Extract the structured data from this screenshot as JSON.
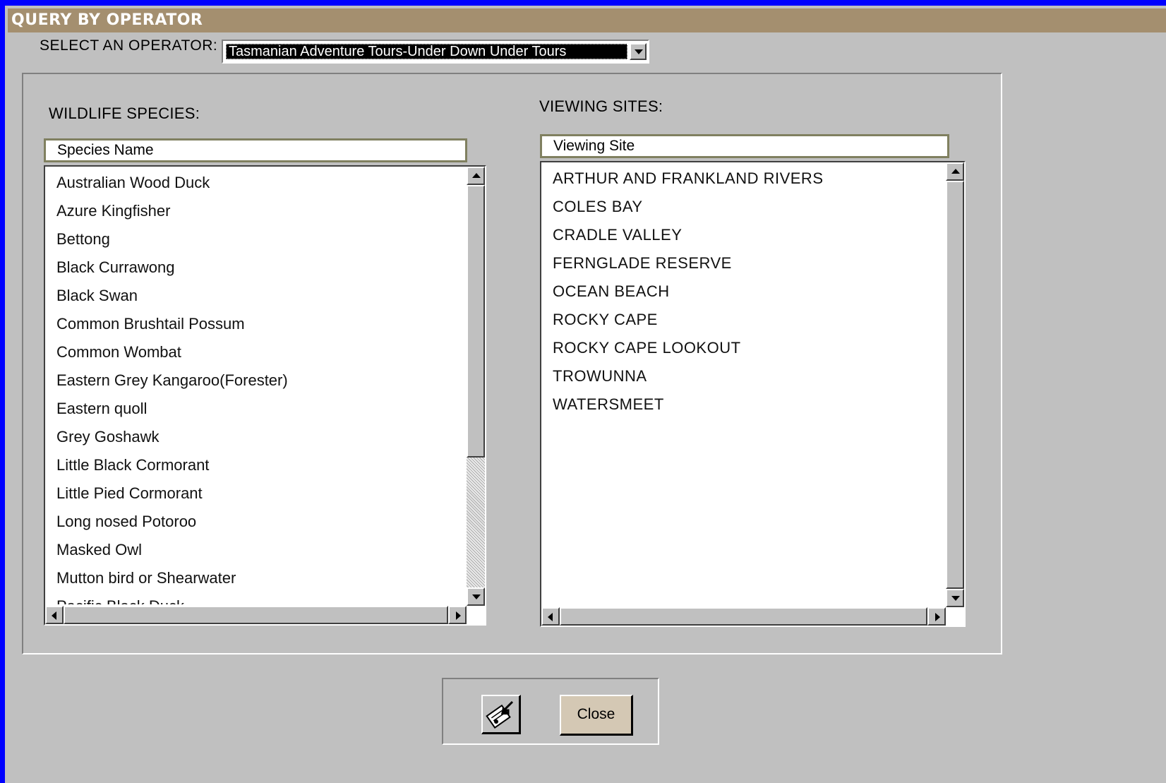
{
  "window": {
    "title": "QUERY BY OPERATOR"
  },
  "operator": {
    "label": "SELECT AN OPERATOR:",
    "selected": "Tasmanian Adventure Tours-Under Down Under Tours"
  },
  "species": {
    "section_label": "WILDLIFE SPECIES:",
    "column_header": "Species Name",
    "items": [
      "Australian Wood Duck",
      "Azure Kingfisher",
      "Bettong",
      "Black Currawong",
      "Black Swan",
      "Common Brushtail Possum",
      "Common Wombat",
      "Eastern Grey Kangaroo(Forester)",
      "Eastern quoll",
      "Grey Goshawk",
      "Little Black Cormorant",
      "Little Pied Cormorant",
      "Long nosed Potoroo",
      "Masked Owl",
      "Mutton bird or Shearwater",
      "Pacific Black Duck"
    ]
  },
  "sites": {
    "section_label": "VIEWING SITES:",
    "column_header": "Viewing Site",
    "items": [
      "ARTHUR AND FRANKLAND RIVERS",
      "COLES BAY",
      "CRADLE VALLEY",
      "FERNGLADE RESERVE",
      "OCEAN BEACH",
      "ROCKY CAPE",
      "ROCKY CAPE LOOKOUT",
      "TROWUNNA",
      "WATERSMEET"
    ]
  },
  "buttons": {
    "icon_button": "report-icon",
    "close_label": "Close"
  },
  "colors": {
    "background": "#0000ff",
    "titlebar": "#a48f6f",
    "form": "#c0c0c0",
    "close_button": "#d4c8b4"
  }
}
